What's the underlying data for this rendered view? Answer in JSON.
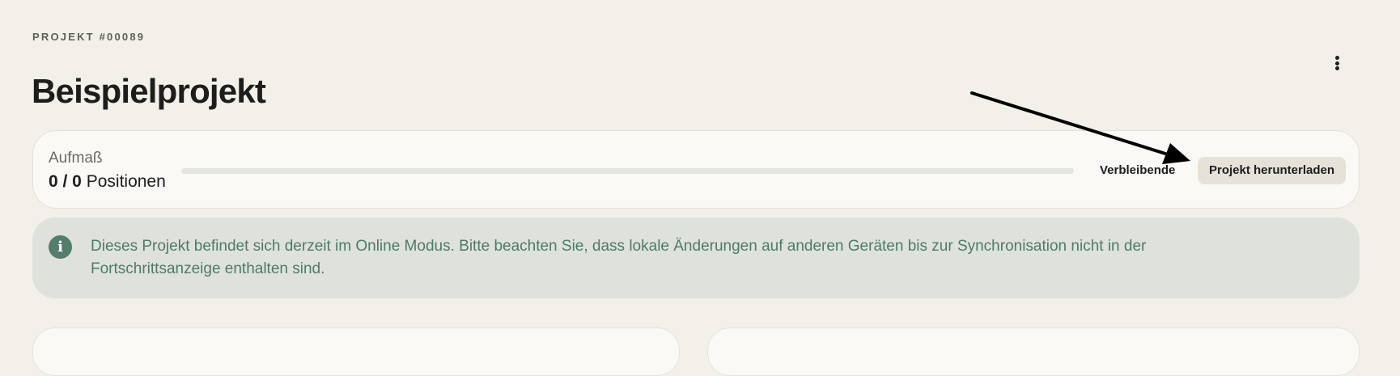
{
  "header": {
    "project_number": "PROJEKT #00089",
    "title": "Beispielprojekt",
    "more_icon": "more-vertical-icon"
  },
  "progress_card": {
    "label": "Aufmaß",
    "count": "0 / 0",
    "unit": "Positionen",
    "progress_fraction": 0,
    "remaining_label": "Verbleibende",
    "download_label": "Projekt herunterladen"
  },
  "info_banner": {
    "icon": "info-icon",
    "glyph": "i",
    "message": "Dieses Projekt befindet sich derzeit im Online Modus. Bitte beachten Sie, dass lokale Änderungen auf anderen Geräten bis zur Synchronisation nicht in der Fortschrittsanzeige enthalten sind."
  },
  "annotation": {
    "icon": "arrow-annotation-icon"
  },
  "colors": {
    "background": "#f3f0e9",
    "card": "#faf9f6",
    "accent_green": "#4e7a69",
    "info_bg": "#dfe2dc",
    "button_bg": "#e6e2da"
  }
}
